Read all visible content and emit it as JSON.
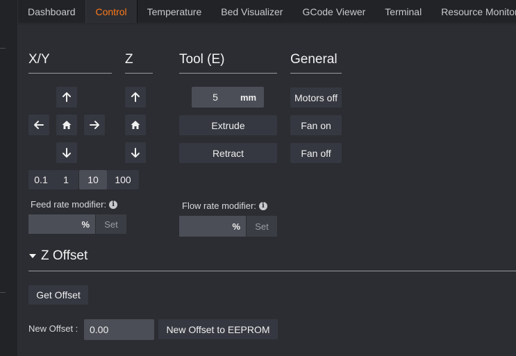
{
  "tabs": [
    {
      "label": "Dashboard",
      "active": false
    },
    {
      "label": "Control",
      "active": true
    },
    {
      "label": "Temperature",
      "active": false
    },
    {
      "label": "Bed Visualizer",
      "active": false
    },
    {
      "label": "GCode Viewer",
      "active": false
    },
    {
      "label": "Terminal",
      "active": false
    },
    {
      "label": "Resource Monitor",
      "active": false
    }
  ],
  "colors": {
    "accent": "#ff7a1a",
    "panel": "#2b2d32",
    "button": "#353840"
  },
  "sections": {
    "xy": "X/Y",
    "z": "Z",
    "tool": "Tool (E)",
    "general": "General"
  },
  "jog": {
    "icons": {
      "up": "arrow-up-icon",
      "down": "arrow-down-icon",
      "left": "arrow-left-icon",
      "right": "arrow-right-icon",
      "home": "home-icon"
    },
    "steps": [
      "0.1",
      "1",
      "10",
      "100"
    ],
    "selected_step": "10"
  },
  "tool": {
    "amount": "5",
    "unit": "mm",
    "extrude_label": "Extrude",
    "retract_label": "Retract"
  },
  "general": {
    "motors_off": "Motors off",
    "fan_on": "Fan on",
    "fan_off": "Fan off"
  },
  "feed_rate": {
    "label": "Feed rate modifier:",
    "value": "",
    "unit": "%",
    "set_label": "Set"
  },
  "flow_rate": {
    "label": "Flow rate modifier:",
    "value": "",
    "unit": "%",
    "set_label": "Set"
  },
  "z_offset": {
    "title": "Z Offset",
    "get_offset_label": "Get Offset",
    "new_offset_label": "New Offset :",
    "new_offset_value": "0.00",
    "save_label": "New Offset to EEPROM"
  }
}
